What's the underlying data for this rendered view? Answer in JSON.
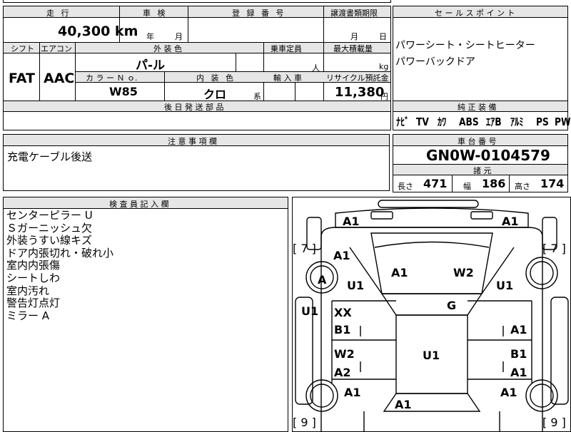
{
  "header": {
    "mileage_label": "走 行",
    "inspection_label": "車 検",
    "registration_label": "登 録 番 号",
    "transfer_label": "譲渡書類期限",
    "sales_point_label": "セ ー ル ス ポ イ ン ト",
    "shift_label": "シフト",
    "aircon_label": "エアコン",
    "exterior_color_label": "外 装 色",
    "capacity_label": "乗車定員",
    "max_load_label": "最大積載量",
    "color_no_label": "カ ラ ー Ｎ ｏ.",
    "interior_color_label": "内 装 色",
    "import_label": "輸 入 車",
    "recycle_label": "リサイクル預託金",
    "later_parts_label": "後 日 発 送 部 品",
    "standard_equipment_label": "純 正 装 備",
    "notes_label": "注 意 事 項 欄",
    "chassis_label": "車 台 番 号",
    "dimensions_label": "諸 元",
    "inspector_label": "検 査 員 記 入 欄"
  },
  "values": {
    "mileage": "40,300 km",
    "year_unit": "年",
    "month_unit": "月",
    "transfer_month_unit": "月",
    "transfer_day_unit": "日",
    "shift": "FAT",
    "aircon": "AAC",
    "exterior_color": "パ-ル",
    "capacity_unit": "人",
    "load_unit": "kg",
    "color_no": "W85",
    "interior_color": "クロ",
    "interior_suffix": "系",
    "recycle_amount": "11,380",
    "recycle_unit": "円"
  },
  "sales_points": [
    "パワーシート・シートヒーター",
    "パワーバックドア"
  ],
  "equipment": [
    "ﾅﾋﾞ",
    "TV",
    "ｶﾜ",
    "ABS",
    "ｴｱB",
    "ｱﾙﾐ",
    "PS",
    "PW"
  ],
  "notes": "充電ケーブル後送",
  "chassis_number": "GN0W-0104579",
  "dimensions": {
    "length_label": "長さ",
    "length": "471",
    "width_label": "幅",
    "width": "186",
    "height_label": "高さ",
    "height": "174"
  },
  "inspector_notes": [
    "センターピラー U",
    "Ｓガーニッシュ欠",
    "外装うすい線キズ",
    "ドア内張切れ・破れ小",
    "室内内張傷",
    "シートしわ",
    "室内汚れ",
    "警告灯点灯",
    "ミラー A"
  ],
  "diagram_marks": {
    "front_bumper_left": "A1",
    "front_bumper_right": "A1",
    "left_bracket": "[ 7 ]",
    "right_bracket": "[ 7 ]",
    "left_fender": "A1",
    "left_wheel": "A",
    "left_fender_lower": "U1",
    "hood_left": "A1",
    "hood_right": "W2",
    "right_fender_lower": "U1",
    "left_pillar": "U1",
    "front_door_left_top": "XX",
    "front_door_left_bottom": "B1",
    "windshield": "G",
    "front_door_right_bottom": "A1",
    "rear_door_left_top": "W2",
    "rear_door_left_bottom": "A2",
    "roof": "U1",
    "rear_door_right_top": "B1",
    "rear_door_right_bottom": "A1",
    "rear_left": "A1",
    "rear_right": "A1",
    "rear_center": "A1",
    "bottom_left_bracket": "[ 9 ]",
    "bottom_right_bracket": "[ 9 ]"
  }
}
